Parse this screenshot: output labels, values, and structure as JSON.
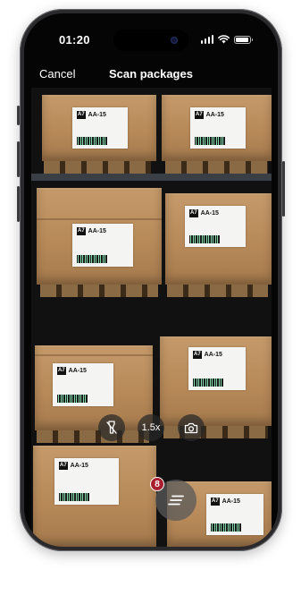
{
  "status_bar": {
    "time": "01:20",
    "icons": [
      "signal-icon",
      "wifi-icon",
      "battery-icon"
    ]
  },
  "nav": {
    "cancel_label": "Cancel",
    "title": "Scan packages"
  },
  "camera_view": {
    "boxes": [
      {
        "label_code": "A7",
        "label_id": "AA-15"
      },
      {
        "label_code": "A7",
        "label_id": "AA-15"
      },
      {
        "label_code": "A7",
        "label_id": "AA-15"
      },
      {
        "label_code": "A7",
        "label_id": "AA-15"
      },
      {
        "label_code": "A7",
        "label_id": "AA-15"
      },
      {
        "label_code": "A7",
        "label_id": "AA-15"
      },
      {
        "label_code": "A7",
        "label_id": "AA-15"
      },
      {
        "label_code": "A7",
        "label_id": "AA-15"
      }
    ]
  },
  "controls": {
    "flashlight_icon": "flashlight-off-icon",
    "zoom_label": "1.5x",
    "camera_icon": "camera-icon",
    "scanned_list_icon": "list-icon",
    "scanned_count": "8"
  },
  "colors": {
    "badge": "#a81e2e",
    "barcode_green": "#7fd9a8",
    "cardboard": "#b68858"
  }
}
